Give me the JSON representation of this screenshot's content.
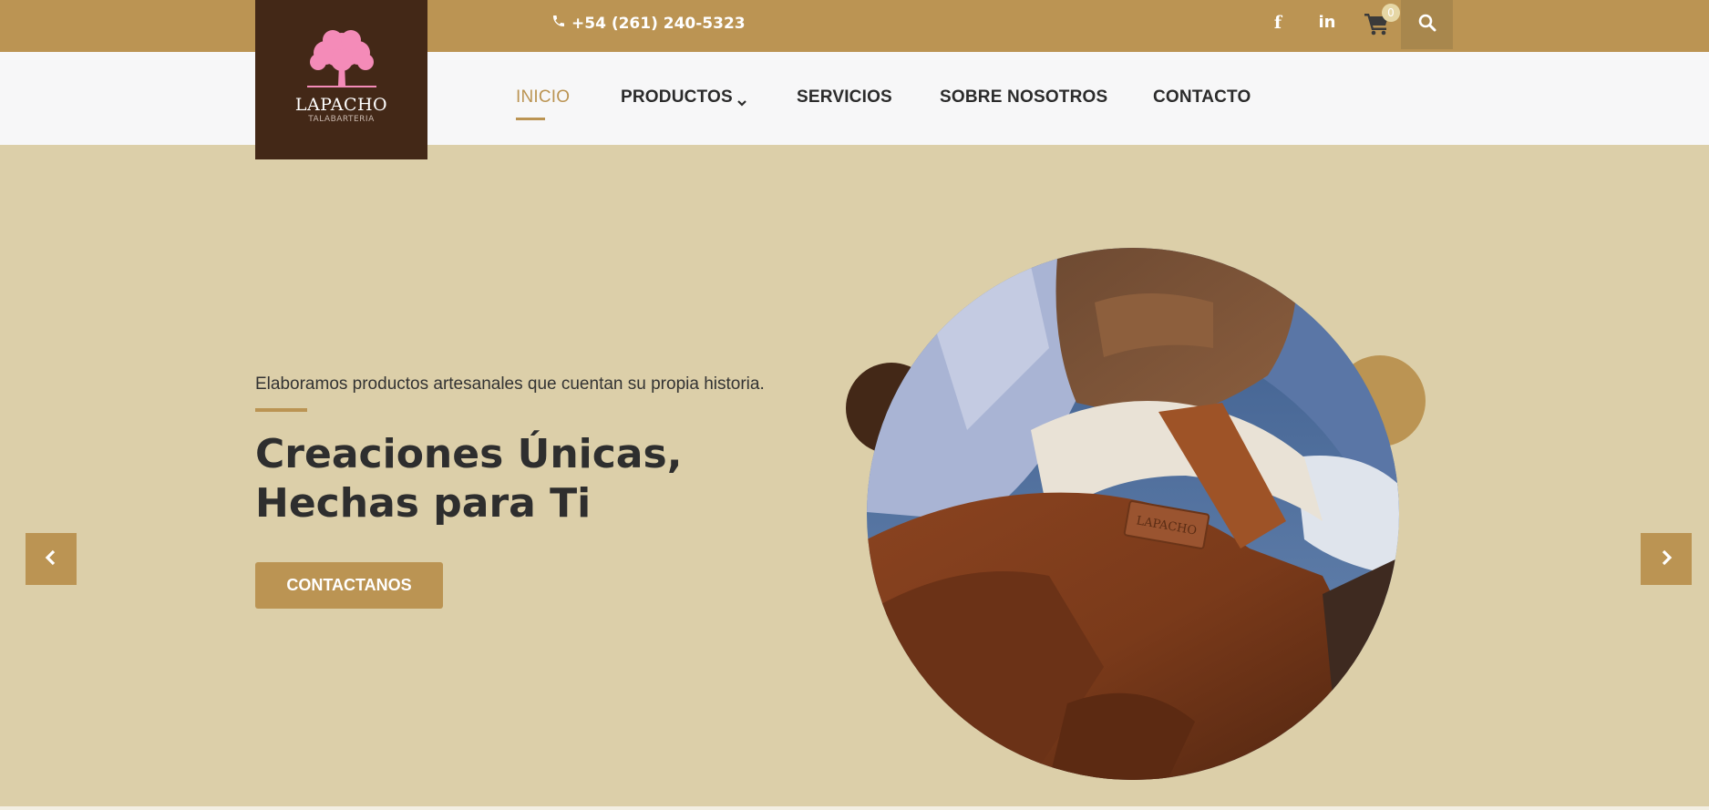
{
  "topbar": {
    "phone_icon": "phone-icon",
    "phone": "+54 (261) 240-5323",
    "facebook_icon": "facebook-icon",
    "facebook_glyph": "f",
    "linkedin_icon": "linkedin-icon",
    "linkedin_glyph": "in",
    "cart_icon": "cart-icon",
    "cart_count": "0",
    "search_icon": "search-icon"
  },
  "brand": {
    "name": "LAPACHO",
    "tagline": "TALABARTERIA",
    "tree_color": "#f48bb8"
  },
  "nav": {
    "items": [
      {
        "label": "INICIO",
        "active": true
      },
      {
        "label": "PRODUCTOS",
        "has_dropdown": true
      },
      {
        "label": "SERVICIOS"
      },
      {
        "label": "SOBRE NOSOTROS"
      },
      {
        "label": "CONTACTO"
      }
    ]
  },
  "hero": {
    "subtitle": "Elaboramos productos artesanales que cuentan su propia historia.",
    "headline": "Creaciones Únicas, Hechas para Ti",
    "cta": "CONTACTANOS",
    "image_label": "LAPACHO",
    "prev_icon": "chevron-left-icon",
    "next_icon": "chevron-right-icon"
  },
  "colors": {
    "gold": "#bb9453",
    "dark_brown": "#432817",
    "background": "#dccfa9",
    "text": "#2e2e2e"
  }
}
